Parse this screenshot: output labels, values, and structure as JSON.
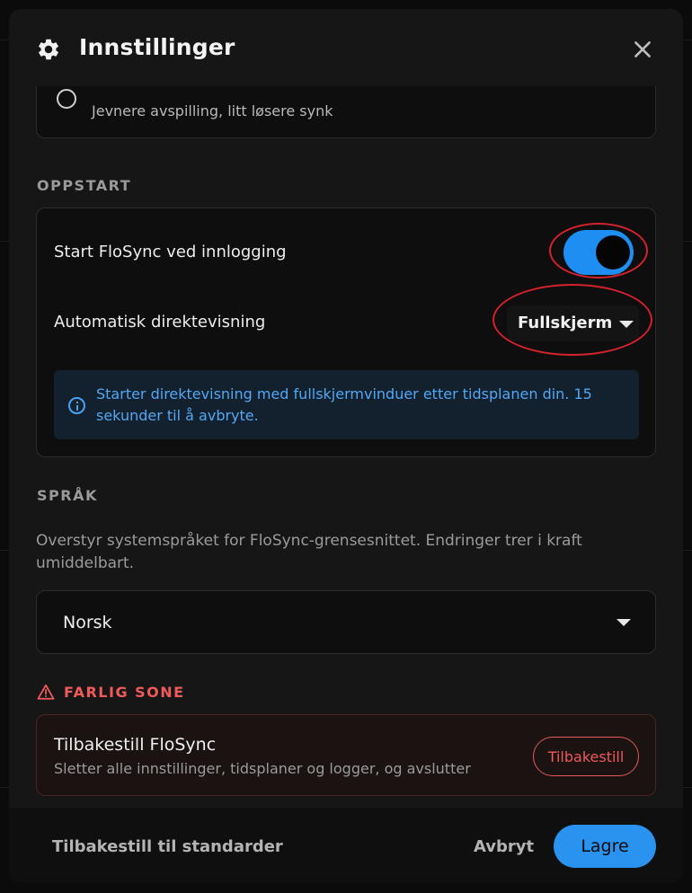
{
  "header": {
    "title": "Innstillinger",
    "icon": "gear-icon",
    "close_icon": "close-icon"
  },
  "playback_option": {
    "description": "Jevnere avspilling, litt løsere synk"
  },
  "startup": {
    "section_label": "OPPSTART",
    "launch_on_login_label": "Start FloSync ved innlogging",
    "launch_on_login_enabled": true,
    "auto_live_label": "Automatisk direktevisning",
    "auto_live_value": "Fullskjerm",
    "info_text": "Starter direktevisning med fullskjermvinduer etter tidsplanen din. 15 sekunder til å avbryte."
  },
  "language": {
    "section_label": "SPRÅK",
    "description": "Overstyr systemspråket for FloSync-grensesnittet. Endringer trer i kraft umiddelbart.",
    "selected": "Norsk"
  },
  "danger_zone": {
    "section_label": "FARLIG SONE",
    "title": "Tilbakestill FloSync",
    "description": "Sletter alle innstillinger, tidsplaner og logger, og avslutter",
    "button_label": "Tilbakestill"
  },
  "footer": {
    "reset_defaults_label": "Tilbakestill til standarder",
    "cancel_label": "Avbryt",
    "save_label": "Lagre"
  },
  "colors": {
    "accent": "#2a92ef",
    "danger": "#ef5a5a",
    "annotation_ring": "#d4222d",
    "info": "#51a8f4"
  }
}
